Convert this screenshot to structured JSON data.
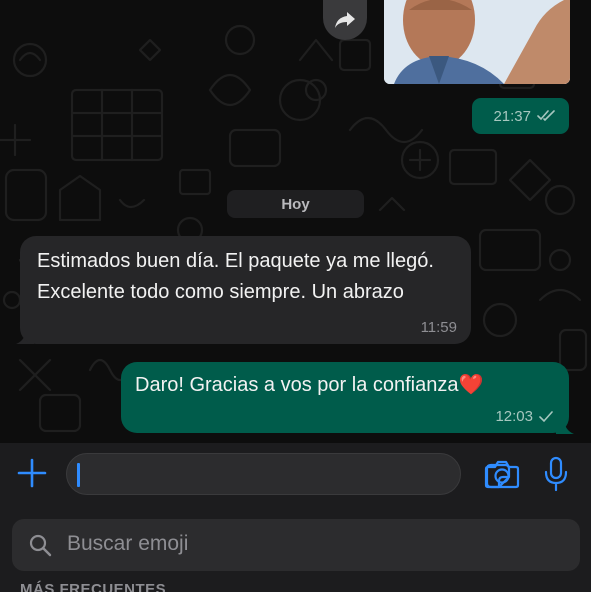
{
  "conversation": {
    "earlier_message": {
      "time": "21:37",
      "status_icon": "double-check-icon"
    },
    "date_separator": "Hoy",
    "incoming": {
      "text": "Estimados buen día. El paquete ya me llegó. Excelente todo como siempre. Un abrazo",
      "time": "11:59"
    },
    "outgoing": {
      "text": "Daro! Gracias a vos por la confianza❤️",
      "time": "12:03",
      "status_icon": "single-check-icon"
    }
  },
  "composer": {
    "value": "",
    "icons": [
      "plus-icon",
      "sticker-icon",
      "camera-icon",
      "microphone-icon"
    ]
  },
  "emoji_panel": {
    "search_placeholder": "Buscar emoji",
    "section_title": "MÁS FRECUENTES"
  },
  "colors": {
    "outgoing_bubble": "#005c4b",
    "incoming_bubble": "#262628",
    "accent": "#2f8cff"
  }
}
